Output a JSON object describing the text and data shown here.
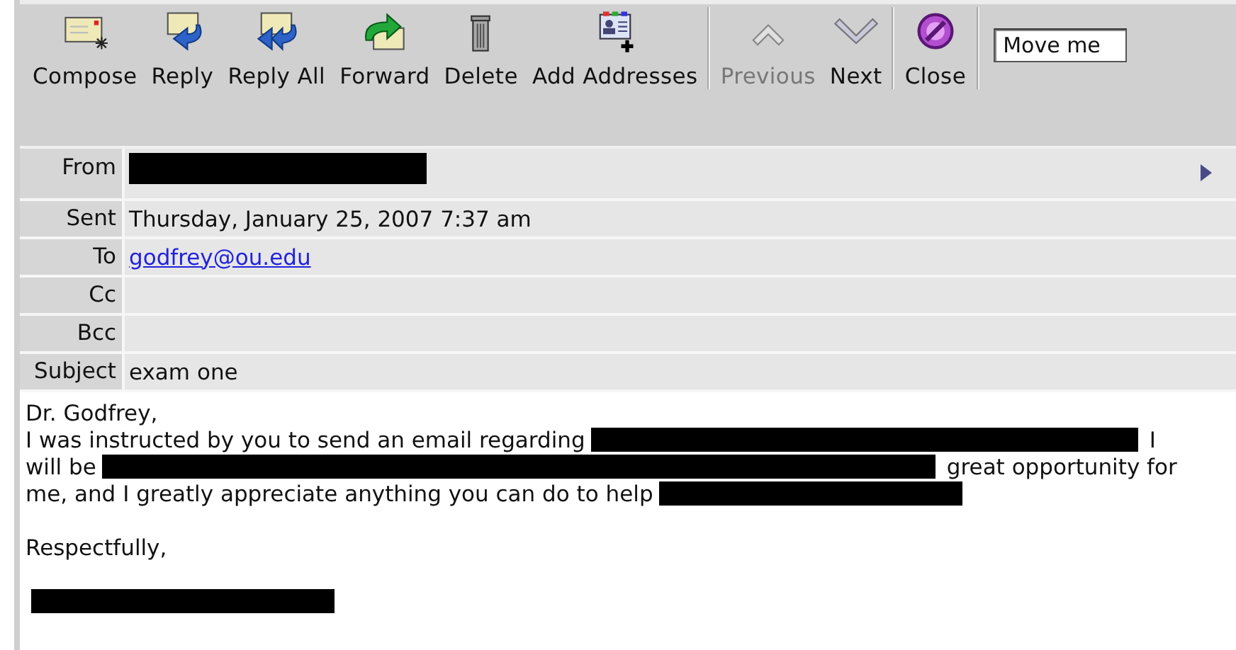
{
  "toolbar": {
    "buttons": [
      {
        "kind": "compose",
        "label": "Compose",
        "disabled": false
      },
      {
        "kind": "reply",
        "label": "Reply",
        "disabled": false
      },
      {
        "kind": "reply_all",
        "label": "Reply All",
        "disabled": false
      },
      {
        "kind": "forward",
        "label": "Forward",
        "disabled": false
      },
      {
        "kind": "delete",
        "label": "Delete",
        "disabled": false
      },
      {
        "kind": "add_addresses",
        "label": "Add Addresses",
        "disabled": false
      },
      {
        "kind": "previous",
        "label": "Previous",
        "disabled": true,
        "group_start": true
      },
      {
        "kind": "next",
        "label": "Next",
        "disabled": false
      },
      {
        "kind": "close",
        "label": "Close",
        "disabled": false,
        "group_start": true
      }
    ],
    "move_select": {
      "value": "Move me"
    }
  },
  "headers": [
    {
      "kind": "redacted",
      "label": "From"
    },
    {
      "kind": "text",
      "label": "Sent",
      "value": "Thursday, January 25, 2007 7:37 am"
    },
    {
      "kind": "link",
      "label": "To",
      "value": "godfrey@ou.edu"
    },
    {
      "kind": "empty",
      "label": "Cc"
    },
    {
      "kind": "empty",
      "label": "Bcc"
    },
    {
      "kind": "text",
      "label": "Subject",
      "value": "exam one"
    }
  ],
  "body": [
    {
      "lines": [
        [
          {
            "kind": "text",
            "text": "Dr. Godfrey,"
          }
        ],
        [
          {
            "kind": "text",
            "text": "I was instructed by you to send an email regarding"
          },
          {
            "kind": "redacted"
          },
          {
            "kind": "text",
            "text": "I"
          }
        ],
        [
          {
            "kind": "text",
            "text": "will be"
          },
          {
            "kind": "redacted"
          },
          {
            "kind": "text",
            "text": "great opportunity for"
          }
        ],
        [
          {
            "kind": "text",
            "text": "me, and I greatly appreciate anything you can do to help"
          },
          {
            "kind": "redacted"
          }
        ]
      ]
    },
    {
      "lines": [
        [
          {
            "kind": "text",
            "text": "Respectfully,"
          }
        ]
      ]
    },
    {
      "lines": [
        [
          {
            "kind": "redacted"
          }
        ]
      ]
    }
  ]
}
